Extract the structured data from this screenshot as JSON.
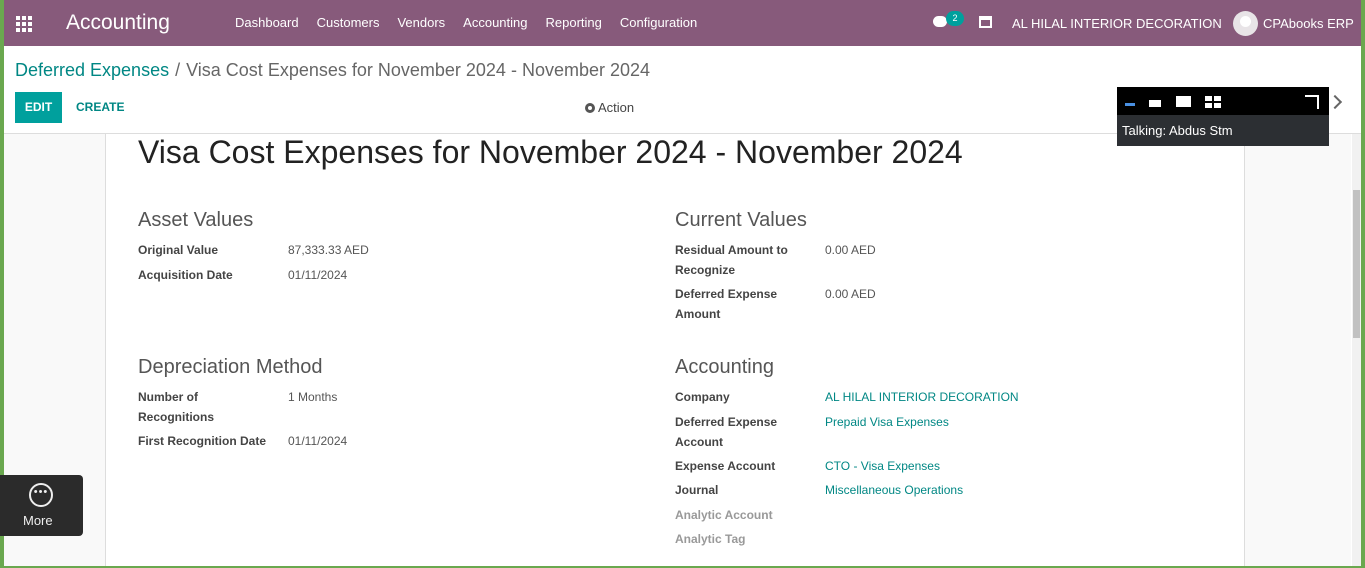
{
  "navbar": {
    "brand": "Accounting",
    "menu": [
      "Dashboard",
      "Customers",
      "Vendors",
      "Accounting",
      "Reporting",
      "Configuration"
    ],
    "chat_count": "2",
    "company": "AL HILAL INTERIOR DECORATION",
    "user": "CPAbooks ERP",
    "icons": [
      "apps-icon",
      "chat-icon",
      "gift-icon",
      "avatar"
    ]
  },
  "breadcrumb": {
    "parent": "Deferred Expenses",
    "separator": "/",
    "current": "Visa Cost Expenses for November 2024 - November 2024"
  },
  "buttons": {
    "edit": "EDIT",
    "create": "CREATE",
    "action": "Action"
  },
  "record": {
    "title": "Visa Cost Expenses for November 2024 - November 2024",
    "asset_values": {
      "heading": "Asset Values",
      "original_value_label": "Original Value",
      "original_value": "87,333.33 AED",
      "acquisition_date_label": "Acquisition Date",
      "acquisition_date": "01/11/2024"
    },
    "current_values": {
      "heading": "Current Values",
      "residual_label": "Residual Amount to Recognize",
      "residual": "0.00 AED",
      "deferred_amount_label": "Deferred Expense Amount",
      "deferred_amount": "0.00 AED"
    },
    "depreciation": {
      "heading": "Depreciation Method",
      "recognitions_label": "Number of Recognitions",
      "recognitions": "1  Months",
      "first_date_label": "First Recognition Date",
      "first_date": "01/11/2024"
    },
    "accounting": {
      "heading": "Accounting",
      "company_label": "Company",
      "company": "AL HILAL INTERIOR DECORATION",
      "deferred_account_label": "Deferred Expense Account",
      "deferred_account": "Prepaid Visa Expenses",
      "expense_account_label": "Expense Account",
      "expense_account": "CTO - Visa Expenses",
      "journal_label": "Journal",
      "journal": "Miscellaneous Operations",
      "analytic_account_label": "Analytic Account",
      "analytic_tag_label": "Analytic Tag"
    }
  },
  "call_widget": {
    "status": "Talking: Abdus Stm"
  },
  "more_button": {
    "label": "More"
  },
  "colors": {
    "navbar": "#875a7b",
    "primary": "#00a09d",
    "link": "#008784"
  }
}
